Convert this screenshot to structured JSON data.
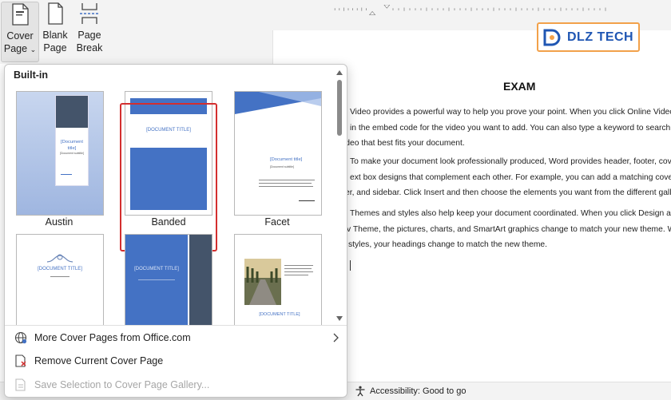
{
  "ribbon": {
    "cover_page": {
      "label_line1": "Cover",
      "label_line2": "Page",
      "icon": "cover-page-icon"
    },
    "blank_page": {
      "label_line1": "Blank",
      "label_line2": "Page",
      "icon": "blank-page-icon"
    },
    "page_break": {
      "label_line1": "Page",
      "label_line2": "Break",
      "icon": "page-break-icon"
    }
  },
  "gallery": {
    "section": "Built-in",
    "items": [
      {
        "label": "Austin",
        "title_text": "[Document title]",
        "subtitle_text": "[Document subtitle]"
      },
      {
        "label": "Banded",
        "title_text": "[DOCUMENT TITLE]",
        "selected": true
      },
      {
        "label": "Facet",
        "title_text": "[Document title]",
        "subtitle_text": "[Document subtitle]"
      },
      {
        "label": "",
        "title_text": "[DOCUMENT TITLE]"
      },
      {
        "label": "",
        "title_text": "[DOCUMENT TITLE]"
      },
      {
        "label": "",
        "title_text": "[DOCUMENT TITLE]"
      }
    ]
  },
  "menu": {
    "more": {
      "label": "More Cover Pages from Office.com",
      "icon": "globe-icon"
    },
    "remove": {
      "label": "Remove Current Cover Page",
      "icon": "remove-cover-icon"
    },
    "save": {
      "label": "Save Selection to Cover Page Gallery...",
      "icon": "save-gallery-icon",
      "disabled": true
    }
  },
  "document": {
    "logo_text": "DLZ TECH",
    "title": "EXAM",
    "paragraphs": [
      [
        "Video provides a powerful way to help you prove your point. When you click Online Video, yo",
        "in the embed code for the video you want to add. You can also type a keyword to search onli",
        "ideo that best fits your document."
      ],
      [
        "To make your document look professionally produced, Word provides header, footer, cover",
        "ext box designs that complement each other. For example, you can add a matching cover",
        "er, and sidebar. Click Insert and then choose the elements you want from the different gallerie"
      ],
      [
        "Themes and styles also help keep your document coordinated. When you click Design and c",
        "v Theme, the pictures, charts, and SmartArt graphics change to match your new theme. Whe",
        "styles, your headings change to match the new theme."
      ]
    ]
  },
  "status_bar": {
    "accessibility": "Accessibility: Good to go"
  },
  "colors": {
    "accent_blue": "#4472c4",
    "selection_red": "#d32f2f",
    "logo_orange": "#f2a14a"
  }
}
